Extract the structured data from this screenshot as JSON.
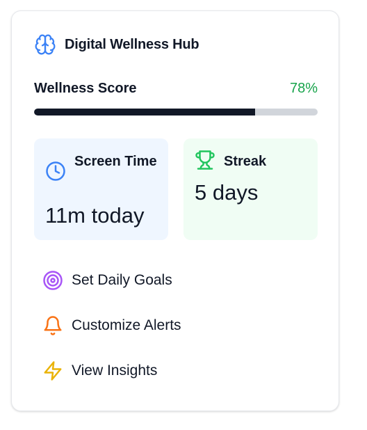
{
  "header": {
    "title": "Digital Wellness Hub",
    "icon": "brain-icon"
  },
  "wellness": {
    "label": "Wellness Score",
    "value_text": "78%",
    "percent": 78
  },
  "stats": {
    "screen_time": {
      "label": "Screen Time",
      "value": "11m today",
      "icon": "clock-icon"
    },
    "streak": {
      "label": "Streak",
      "value": "5 days",
      "icon": "trophy-icon"
    }
  },
  "actions": [
    {
      "label": "Set Daily Goals",
      "icon": "target-icon"
    },
    {
      "label": "Customize Alerts",
      "icon": "bell-icon"
    },
    {
      "label": "View Insights",
      "icon": "lightning-icon"
    }
  ],
  "colors": {
    "brand_blue": "#3b82f6",
    "score_green": "#16a34a",
    "progress_fill": "#111827",
    "progress_track": "#d1d5db",
    "screen_card_bg": "#eff6ff",
    "streak_card_bg": "#f0fdf4",
    "trophy_green": "#22c55e",
    "target_purple": "#a855f7",
    "bell_orange": "#f97316",
    "bolt_yellow": "#eab308"
  }
}
